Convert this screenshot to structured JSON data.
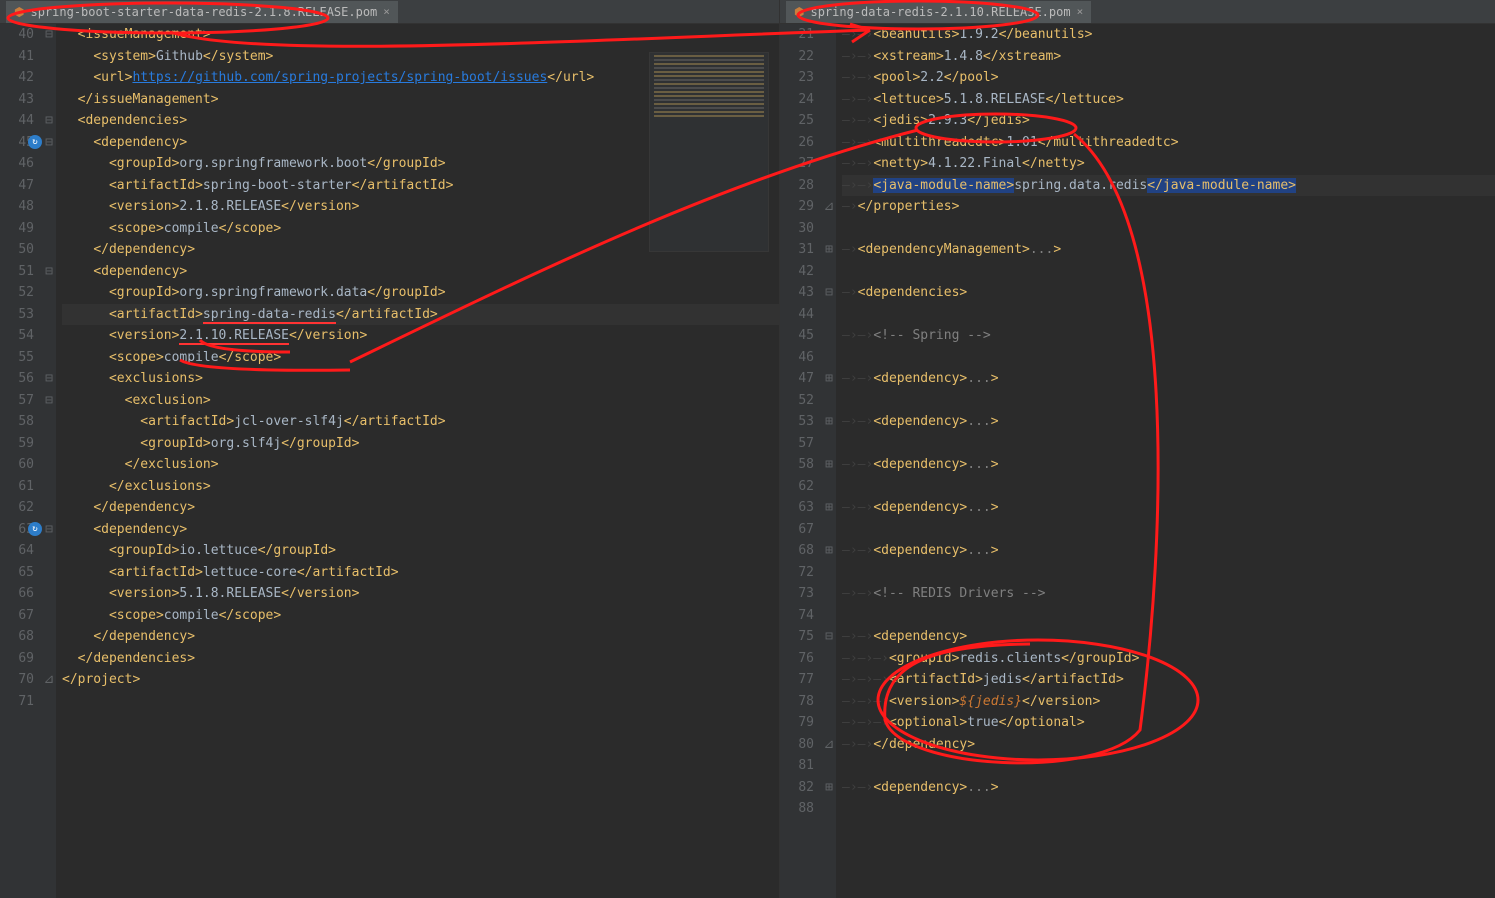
{
  "left": {
    "tab_label": "spring-boot-starter-data-redis-2.1.8.RELEASE.pom",
    "lines": [
      {
        "n": 40,
        "fold": "⊟",
        "indent": 1,
        "parts": [
          {
            "t": "tag",
            "o": "issueManagement"
          }
        ]
      },
      {
        "n": 41,
        "indent": 2,
        "parts": [
          {
            "t": "tag",
            "o": "system",
            "c": "system",
            "txt": "Github"
          }
        ]
      },
      {
        "n": 42,
        "indent": 2,
        "parts": [
          {
            "t": "tag",
            "o": "url",
            "c": "url",
            "link": "https://github.com/spring-projects/spring-boot/issues"
          }
        ]
      },
      {
        "n": 43,
        "indent": 1,
        "parts": [
          {
            "t": "close",
            "v": "issueManagement"
          }
        ]
      },
      {
        "n": 44,
        "fold": "⊟",
        "indent": 1,
        "parts": [
          {
            "t": "tag",
            "o": "dependencies"
          }
        ]
      },
      {
        "n": 45,
        "fold": "⊟",
        "indent": 2,
        "icon": true,
        "parts": [
          {
            "t": "tag",
            "o": "dependency"
          }
        ]
      },
      {
        "n": 46,
        "indent": 3,
        "parts": [
          {
            "t": "tag",
            "o": "groupId",
            "c": "groupId",
            "txt": "org.springframework.boot"
          }
        ]
      },
      {
        "n": 47,
        "indent": 3,
        "parts": [
          {
            "t": "tag",
            "o": "artifactId",
            "c": "artifactId",
            "txt": "spring-boot-starter"
          }
        ]
      },
      {
        "n": 48,
        "indent": 3,
        "parts": [
          {
            "t": "tag",
            "o": "version",
            "c": "version",
            "txt": "2.1.8.RELEASE"
          }
        ]
      },
      {
        "n": 49,
        "indent": 3,
        "parts": [
          {
            "t": "tag",
            "o": "scope",
            "c": "scope",
            "txt": "compile"
          }
        ]
      },
      {
        "n": 50,
        "indent": 2,
        "parts": [
          {
            "t": "close",
            "v": "dependency"
          }
        ]
      },
      {
        "n": 51,
        "fold": "⊟",
        "indent": 2,
        "parts": [
          {
            "t": "tag",
            "o": "dependency"
          }
        ]
      },
      {
        "n": 52,
        "indent": 3,
        "parts": [
          {
            "t": "tag",
            "o": "groupId",
            "c": "groupId",
            "txt": "org.springframework.data"
          }
        ]
      },
      {
        "n": 53,
        "indent": 3,
        "hl": true,
        "parts": [
          {
            "t": "tag",
            "o": "artifactId",
            "c": "artifactId",
            "txt": "spring-data-redis",
            "ul": true
          }
        ]
      },
      {
        "n": 54,
        "indent": 3,
        "parts": [
          {
            "t": "tag",
            "o": "version",
            "c": "version",
            "txt": "2.1.10.RELEASE",
            "ul": true
          }
        ]
      },
      {
        "n": 55,
        "indent": 3,
        "parts": [
          {
            "t": "tag",
            "o": "scope",
            "c": "scope",
            "txt": "compile"
          }
        ]
      },
      {
        "n": 56,
        "fold": "⊟",
        "indent": 3,
        "parts": [
          {
            "t": "tag",
            "o": "exclusions"
          }
        ]
      },
      {
        "n": 57,
        "fold": "⊟",
        "indent": 4,
        "parts": [
          {
            "t": "tag",
            "o": "exclusion"
          }
        ]
      },
      {
        "n": 58,
        "indent": 5,
        "parts": [
          {
            "t": "tag",
            "o": "artifactId",
            "c": "artifactId",
            "txt": "jcl-over-slf4j"
          }
        ]
      },
      {
        "n": 59,
        "indent": 5,
        "parts": [
          {
            "t": "tag",
            "o": "groupId",
            "c": "groupId",
            "txt": "org.slf4j"
          }
        ]
      },
      {
        "n": 60,
        "indent": 4,
        "parts": [
          {
            "t": "close",
            "v": "exclusion"
          }
        ]
      },
      {
        "n": 61,
        "indent": 3,
        "parts": [
          {
            "t": "close",
            "v": "exclusions"
          }
        ]
      },
      {
        "n": 62,
        "indent": 2,
        "parts": [
          {
            "t": "close",
            "v": "dependency"
          }
        ]
      },
      {
        "n": 63,
        "fold": "⊟",
        "indent": 2,
        "icon": true,
        "parts": [
          {
            "t": "tag",
            "o": "dependency"
          }
        ]
      },
      {
        "n": 64,
        "indent": 3,
        "parts": [
          {
            "t": "tag",
            "o": "groupId",
            "c": "groupId",
            "txt": "io.lettuce"
          }
        ]
      },
      {
        "n": 65,
        "indent": 3,
        "parts": [
          {
            "t": "tag",
            "o": "artifactId",
            "c": "artifactId",
            "txt": "lettuce-core"
          }
        ]
      },
      {
        "n": 66,
        "indent": 3,
        "parts": [
          {
            "t": "tag",
            "o": "version",
            "c": "version",
            "txt": "5.1.8.RELEASE"
          }
        ]
      },
      {
        "n": 67,
        "indent": 3,
        "parts": [
          {
            "t": "tag",
            "o": "scope",
            "c": "scope",
            "txt": "compile"
          }
        ]
      },
      {
        "n": 68,
        "indent": 2,
        "parts": [
          {
            "t": "close",
            "v": "dependency"
          }
        ]
      },
      {
        "n": 69,
        "indent": 1,
        "parts": [
          {
            "t": "close",
            "v": "dependencies"
          }
        ]
      },
      {
        "n": 70,
        "fold": "⊿",
        "indent": 0,
        "parts": [
          {
            "t": "close",
            "v": "project"
          }
        ]
      },
      {
        "n": 71,
        "indent": 0,
        "parts": []
      }
    ]
  },
  "right": {
    "tab_label": "spring-data-redis-2.1.10.RELEASE.pom",
    "lines": [
      {
        "n": 21,
        "indent": 2,
        "parts": [
          {
            "t": "tag",
            "o": "beanutils",
            "c": "beanutils",
            "txt": "1.9.2"
          }
        ]
      },
      {
        "n": 22,
        "indent": 2,
        "parts": [
          {
            "t": "tag",
            "o": "xstream",
            "c": "xstream",
            "txt": "1.4.8"
          }
        ]
      },
      {
        "n": 23,
        "indent": 2,
        "parts": [
          {
            "t": "tag",
            "o": "pool",
            "c": "pool",
            "txt": "2.2"
          }
        ]
      },
      {
        "n": 24,
        "indent": 2,
        "parts": [
          {
            "t": "tag",
            "o": "lettuce",
            "c": "lettuce",
            "txt": "5.1.8.RELEASE"
          }
        ]
      },
      {
        "n": 25,
        "indent": 2,
        "parts": [
          {
            "t": "tag",
            "o": "jedis",
            "c": "jedis",
            "txt": "2.9.3"
          }
        ]
      },
      {
        "n": 26,
        "indent": 2,
        "parts": [
          {
            "t": "tag",
            "o": "multithreadedtc",
            "c": "multithreadedtc",
            "txt": "1.01"
          }
        ]
      },
      {
        "n": 27,
        "indent": 2,
        "parts": [
          {
            "t": "tag",
            "o": "netty",
            "c": "netty",
            "txt": "4.1.22.Final"
          }
        ]
      },
      {
        "n": 28,
        "indent": 2,
        "hl": true,
        "sel": true,
        "parts": [
          {
            "t": "tag",
            "o": "java-module-name",
            "c": "java-module-name",
            "txt": "spring.data.redis"
          }
        ]
      },
      {
        "n": 29,
        "fold": "⊿",
        "indent": 1,
        "parts": [
          {
            "t": "close",
            "v": "properties"
          }
        ]
      },
      {
        "n": 30,
        "indent": 0,
        "parts": []
      },
      {
        "n": 31,
        "fold": "⊞",
        "indent": 1,
        "parts": [
          {
            "t": "tag",
            "o": "dependencyManagement",
            "dots": true
          }
        ]
      },
      {
        "n": 42,
        "indent": 0,
        "parts": []
      },
      {
        "n": 43,
        "fold": "⊟",
        "indent": 1,
        "parts": [
          {
            "t": "tag",
            "o": "dependencies"
          }
        ]
      },
      {
        "n": 44,
        "indent": 0,
        "parts": []
      },
      {
        "n": 45,
        "indent": 2,
        "parts": [
          {
            "t": "comment",
            "v": "<!-- Spring -->"
          }
        ]
      },
      {
        "n": 46,
        "indent": 0,
        "parts": []
      },
      {
        "n": 47,
        "fold": "⊞",
        "indent": 2,
        "parts": [
          {
            "t": "tag",
            "o": "dependency",
            "dots": true
          }
        ]
      },
      {
        "n": 52,
        "indent": 0,
        "parts": []
      },
      {
        "n": 53,
        "fold": "⊞",
        "indent": 2,
        "parts": [
          {
            "t": "tag",
            "o": "dependency",
            "dots": true
          }
        ]
      },
      {
        "n": 57,
        "indent": 0,
        "parts": []
      },
      {
        "n": 58,
        "fold": "⊞",
        "indent": 2,
        "parts": [
          {
            "t": "tag",
            "o": "dependency",
            "dots": true
          }
        ]
      },
      {
        "n": 62,
        "indent": 0,
        "parts": []
      },
      {
        "n": 63,
        "fold": "⊞",
        "indent": 2,
        "parts": [
          {
            "t": "tag",
            "o": "dependency",
            "dots": true
          }
        ]
      },
      {
        "n": 67,
        "indent": 0,
        "parts": []
      },
      {
        "n": 68,
        "fold": "⊞",
        "indent": 2,
        "parts": [
          {
            "t": "tag",
            "o": "dependency",
            "dots": true
          }
        ]
      },
      {
        "n": 72,
        "indent": 0,
        "parts": []
      },
      {
        "n": 73,
        "indent": 2,
        "parts": [
          {
            "t": "comment",
            "v": "<!-- REDIS Drivers -->"
          }
        ]
      },
      {
        "n": 74,
        "indent": 0,
        "parts": []
      },
      {
        "n": 75,
        "fold": "⊟",
        "indent": 2,
        "parts": [
          {
            "t": "tag",
            "o": "dependency"
          }
        ]
      },
      {
        "n": 76,
        "indent": 3,
        "parts": [
          {
            "t": "tag",
            "o": "groupId",
            "c": "groupId",
            "txt": "redis.clients"
          }
        ]
      },
      {
        "n": 77,
        "indent": 3,
        "parts": [
          {
            "t": "tag",
            "o": "artifactId",
            "c": "artifactId",
            "txt": "jedis"
          }
        ]
      },
      {
        "n": 78,
        "indent": 3,
        "parts": [
          {
            "t": "tag",
            "o": "version",
            "c": "version",
            "var": "${jedis}"
          }
        ]
      },
      {
        "n": 79,
        "indent": 3,
        "parts": [
          {
            "t": "tag",
            "o": "optional",
            "c": "optional",
            "txt": "true"
          }
        ]
      },
      {
        "n": 80,
        "fold": "⊿",
        "indent": 2,
        "parts": [
          {
            "t": "close",
            "v": "dependency"
          }
        ]
      },
      {
        "n": 81,
        "indent": 0,
        "parts": []
      },
      {
        "n": 82,
        "fold": "⊞",
        "indent": 2,
        "parts": [
          {
            "t": "tag",
            "o": "dependency",
            "dots": true
          }
        ]
      },
      {
        "n": 88,
        "indent": 0,
        "parts": []
      }
    ]
  }
}
